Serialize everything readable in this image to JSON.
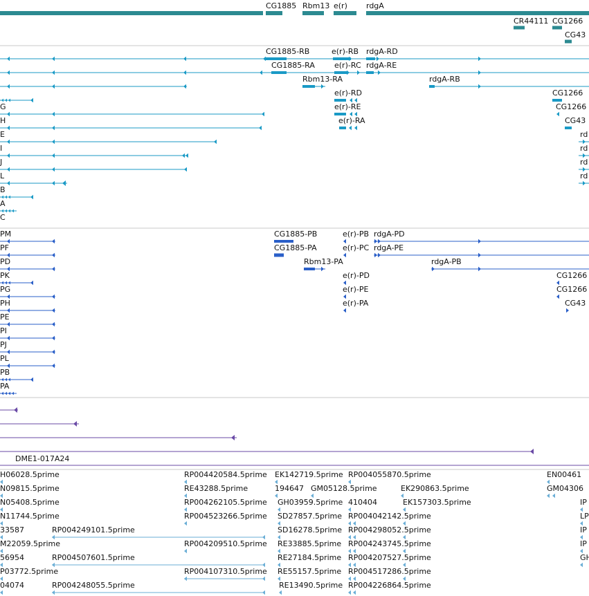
{
  "colors": {
    "gene_span": "#2c8a91",
    "transcript": "#1a9ac6",
    "protein": "#2a5fc8",
    "clone": "#6a4aa6",
    "est": "#6aaed6",
    "divider": "#c8c8c8"
  },
  "tracks": {
    "genes": {
      "labels": [
        "CG1885",
        "Rbm13",
        "e(r)",
        "rdgA",
        "CR44111",
        "CG1266",
        "CG43"
      ]
    },
    "transcripts": {
      "labels": [
        "CG1885-RB",
        "e(r)-RB",
        "rdgA-RD",
        "CG1885-RA",
        "e(r)-RC",
        "rdgA-RE",
        "Rbm13-RA",
        "rdgA-RB",
        "e(r)-RD",
        "CG1266",
        "G",
        "e(r)-RE",
        "CG1266",
        "H",
        "e(r)-RA",
        "CG43",
        "E",
        "rd",
        "I",
        "rd",
        "J",
        "rd",
        "L",
        "rd",
        "B",
        "A",
        "C"
      ]
    },
    "proteins": {
      "labels": [
        "PM",
        "CG1885-PB",
        "e(r)-PB",
        "rdgA-PD",
        "PF",
        "CG1885-PA",
        "e(r)-PC",
        "rdgA-PE",
        "PD",
        "Rbm13-PA",
        "rdgA-PB",
        "PK",
        "e(r)-PD",
        "CG1266",
        "PG",
        "e(r)-PE",
        "CG1266",
        "PH",
        "e(r)-PA",
        "CG43",
        "PE",
        "PI",
        "PJ",
        "PL",
        "PB",
        "PA"
      ]
    },
    "clones": {
      "labels": [
        "DME1-017A24"
      ]
    },
    "ests": {
      "labels": [
        "H06028.5prime",
        "RP004420584.5prime",
        "EK142719.5prime",
        "RP004055870.5prime",
        "EN00461",
        "N09815.5prime",
        "RE43288.5prime",
        "194647",
        "GM05128.5prime",
        "EK290863.5prime",
        "GM04306",
        "N05408.5prime",
        "RP004262105.5prime",
        "GH03959.5prime",
        "410404",
        "EK157303.5prime",
        "IP",
        "N11744.5prime",
        "RP004523266.5prime",
        "SD27857.5prime",
        "RP004042142.5prime",
        "LP",
        "33587",
        "RP004249101.5prime",
        "SD16278.5prime",
        "RP004298052.5prime",
        "IP",
        "M22059.5prime",
        "RP004209510.5prime",
        "RE33885.5prime",
        "RP004243745.5prime",
        "IP",
        "56954",
        "RP004507601.5prime",
        "RE27184.5prime",
        "RP004207527.5prime",
        "GH",
        "P03772.5prime",
        "RP004107310.5prime",
        "RE55157.5prime",
        "RP004517286.5prime",
        "04074",
        "RP004248055.5prime",
        "RE13490.5prime",
        "RP004226864.5prime"
      ]
    }
  }
}
